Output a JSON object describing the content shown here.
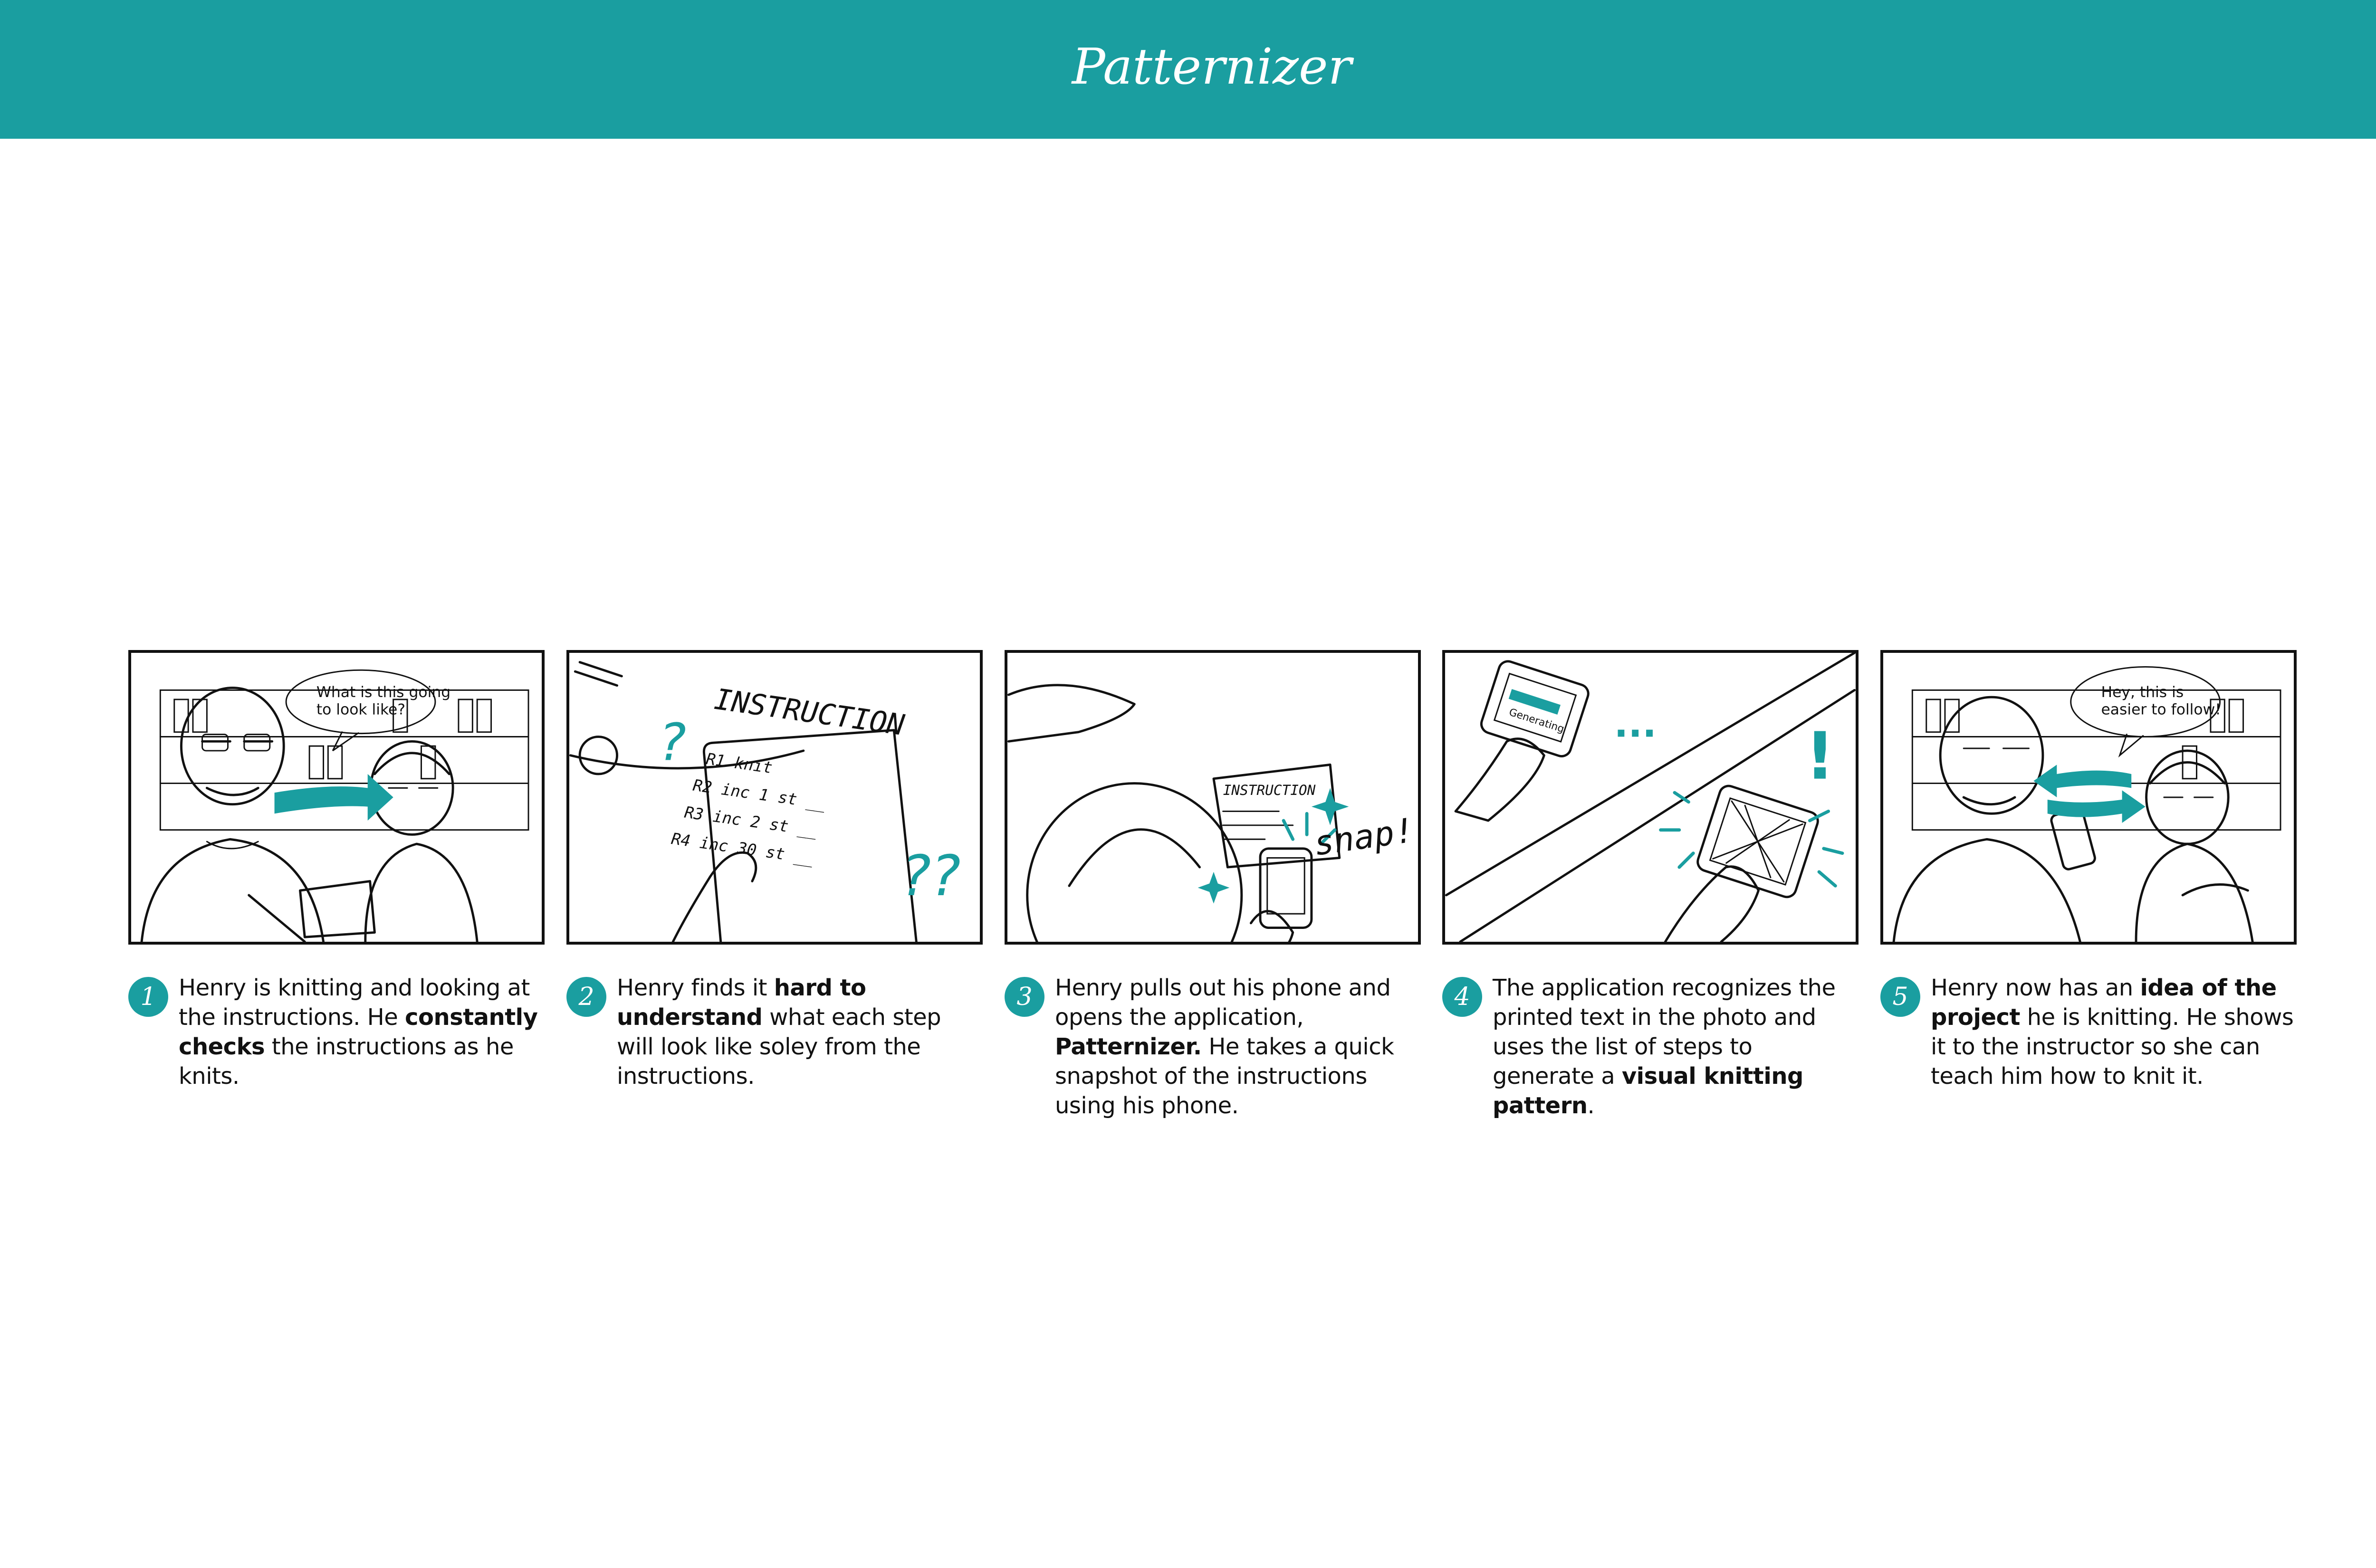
{
  "header": {
    "app_name": "Patternizer",
    "color": "#1a9ea0"
  },
  "panels": [
    {
      "number": "1",
      "bubble": [
        "What is this going",
        "to look like?"
      ],
      "parts": [
        "Henry is knitting and looking at the instructions. He ",
        "constantly checks",
        " the instructions as he knits."
      ]
    },
    {
      "number": "2",
      "sheet_title": "INSTRUCTION",
      "sheet_lines": [
        "R1 knit",
        "R2 inc 1 st __",
        "R3 inc 2 st __",
        "R4 inc 30 st __"
      ],
      "marks": [
        "?",
        "??"
      ],
      "parts": [
        "Henry finds it ",
        "hard to understand",
        " what each step will look like soley from the instructions."
      ]
    },
    {
      "number": "3",
      "sheet_title": "INSTRUCTION",
      "sound": "snap!",
      "parts": [
        "Henry pulls out his phone and opens the application, ",
        "Patternizer.",
        " He takes a quick snapshot of the instructions using his phone."
      ]
    },
    {
      "number": "4",
      "screen_label": "Generating",
      "ellipsis": "...",
      "mark": "!",
      "parts": [
        "The application recognizes the printed text in the photo and uses the list of steps to generate a ",
        "visual knitting pattern",
        "."
      ]
    },
    {
      "number": "5",
      "bubble": [
        "Hey, this is",
        "easier to follow!"
      ],
      "parts": [
        "Henry now has an ",
        "idea of the project",
        " he is knitting. He shows it to the instructor so she can teach him how to knit it."
      ]
    }
  ]
}
